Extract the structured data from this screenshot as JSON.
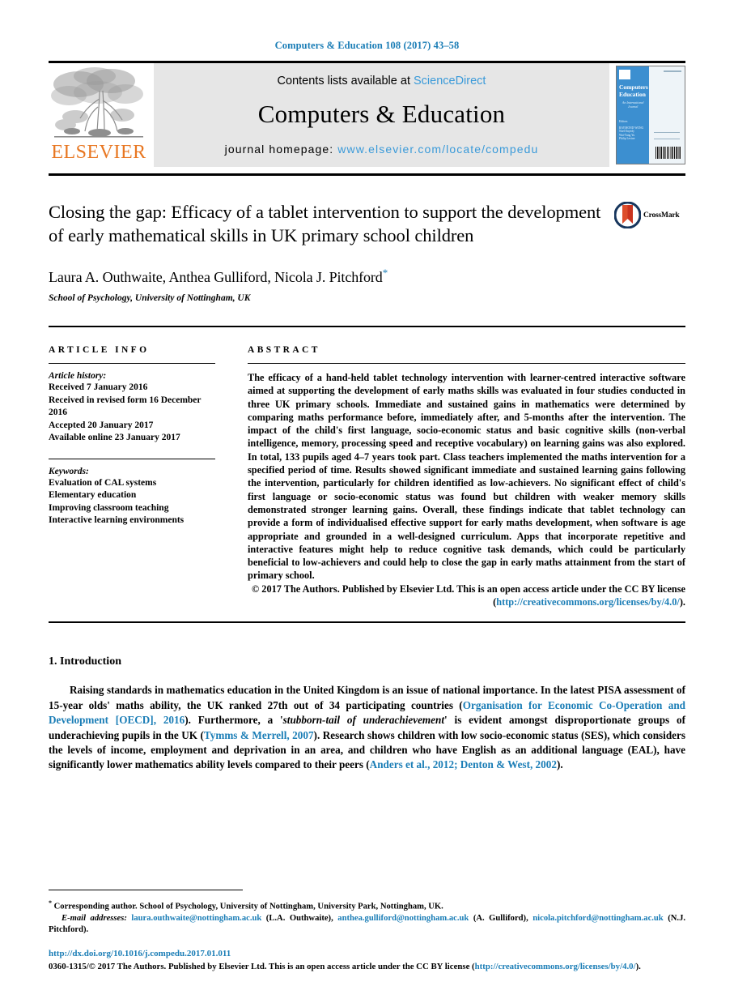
{
  "running_head": "Computers & Education 108 (2017) 43–58",
  "masthead": {
    "publisher_logo_label": "ELSEVIER",
    "contents_prefix": "Contents lists available at ",
    "contents_link": "ScienceDirect",
    "journal_name": "Computers & Education",
    "homepage_prefix": "journal homepage: ",
    "homepage_url": "www.elsevier.com/locate/compedu",
    "cover": {
      "title_line1": "Computers",
      "title_amp": "&",
      "title_line2": "Education",
      "subtitle": "An International Journal",
      "editors_label": "Editors",
      "editors": "RAYMOND WONG\nNoel Enyedy\nWai-Tung Yu\nPhilip Levine"
    }
  },
  "article": {
    "title": "Closing the gap: Efficacy of a tablet intervention to support the development of early mathematical skills in UK primary school children",
    "authors": "Laura A. Outhwaite, Anthea Gulliford, Nicola J. Pitchford",
    "corresponding_marker": "*",
    "affiliation": "School of Psychology, University of Nottingham, UK",
    "crossmark_label": "CrossMark"
  },
  "article_info": {
    "heading": "ARTICLE INFO",
    "history_label": "Article history:",
    "history": [
      "Received 7 January 2016",
      "Received in revised form 16 December 2016",
      "Accepted 20 January 2017",
      "Available online 23 January 2017"
    ],
    "keywords_label": "Keywords:",
    "keywords": [
      "Evaluation of CAL systems",
      "Elementary education",
      "Improving classroom teaching",
      "Interactive learning environments"
    ]
  },
  "abstract": {
    "heading": "ABSTRACT",
    "text": "The efficacy of a hand-held tablet technology intervention with learner-centred interactive software aimed at supporting the development of early maths skills was evaluated in four studies conducted in three UK primary schools. Immediate and sustained gains in mathematics were determined by comparing maths performance before, immediately after, and 5-months after the intervention. The impact of the child's first language, socio-economic status and basic cognitive skills (non-verbal intelligence, memory, processing speed and receptive vocabulary) on learning gains was also explored. In total, 133 pupils aged 4–7 years took part. Class teachers implemented the maths intervention for a specified period of time. Results showed significant immediate and sustained learning gains following the intervention, particularly for children identified as low-achievers. No significant effect of child's first language or socio-economic status was found but children with weaker memory skills demonstrated stronger learning gains. Overall, these findings indicate that tablet technology can provide a form of individualised effective support for early maths development, when software is age appropriate and grounded in a well-designed curriculum. Apps that incorporate repetitive and interactive features might help to reduce cognitive task demands, which could be particularly beneficial to low-achievers and could help to close the gap in early maths attainment from the start of primary school.",
    "copyright_text": "© 2017 The Authors. Published by Elsevier Ltd. This is an open access article under the CC BY license (",
    "copyright_link": "http://creativecommons.org/licenses/by/4.0/",
    "copyright_suffix": ")."
  },
  "introduction": {
    "heading": "1. Introduction",
    "p1_a": "Raising standards in mathematics education in the United Kingdom is an issue of national importance. In the latest PISA assessment of 15-year olds' maths ability, the UK ranked 27th out of 34 participating countries (",
    "p1_cite1": "Organisation for Economic Co-Operation and Development [OECD], 2016",
    "p1_b": "). Furthermore, a '",
    "p1_italic": "stubborn-tail of underachievement",
    "p1_c": "' is evident amongst disproportionate groups of underachieving pupils in the UK (",
    "p1_cite2": "Tymms & Merrell, 2007",
    "p1_d": "). Research shows children with low socio-economic status (SES), which considers the levels of income, employment and deprivation in an area, and children who have English as an additional language (EAL), have significantly lower mathematics ability levels compared to their peers (",
    "p1_cite3": "Anders et al., 2012; Denton & West, 2002",
    "p1_e": ")."
  },
  "footer": {
    "corresponding_marker": "*",
    "corresponding_note": " Corresponding author. School of Psychology, University of Nottingham, University Park, Nottingham, UK.",
    "email_label": "E-mail addresses:",
    "emails": [
      {
        "address": "laura.outhwaite@nottingham.ac.uk",
        "owner": " (L.A. Outhwaite), "
      },
      {
        "address": "anthea.gulliford@nottingham.ac.uk",
        "owner": " (A. Gulliford), "
      },
      {
        "address": "nicola.pitchford@nottingham.ac.uk",
        "owner": " (N.J. Pitchford)."
      }
    ],
    "doi": "http://dx.doi.org/10.1016/j.compedu.2017.01.011",
    "issn_text": "0360-1315/© 2017 The Authors. Published by Elsevier Ltd. This is an open access article under the CC BY license (",
    "issn_link": "http://creativecommons.org/licenses/by/4.0/",
    "issn_suffix": ")."
  },
  "colors": {
    "link": "#1a7db6",
    "science_direct": "#3a9ad9",
    "elsevier_orange": "#e87722",
    "band_gray": "#e6e6e6",
    "cover_blue": "#3c8fd0"
  }
}
